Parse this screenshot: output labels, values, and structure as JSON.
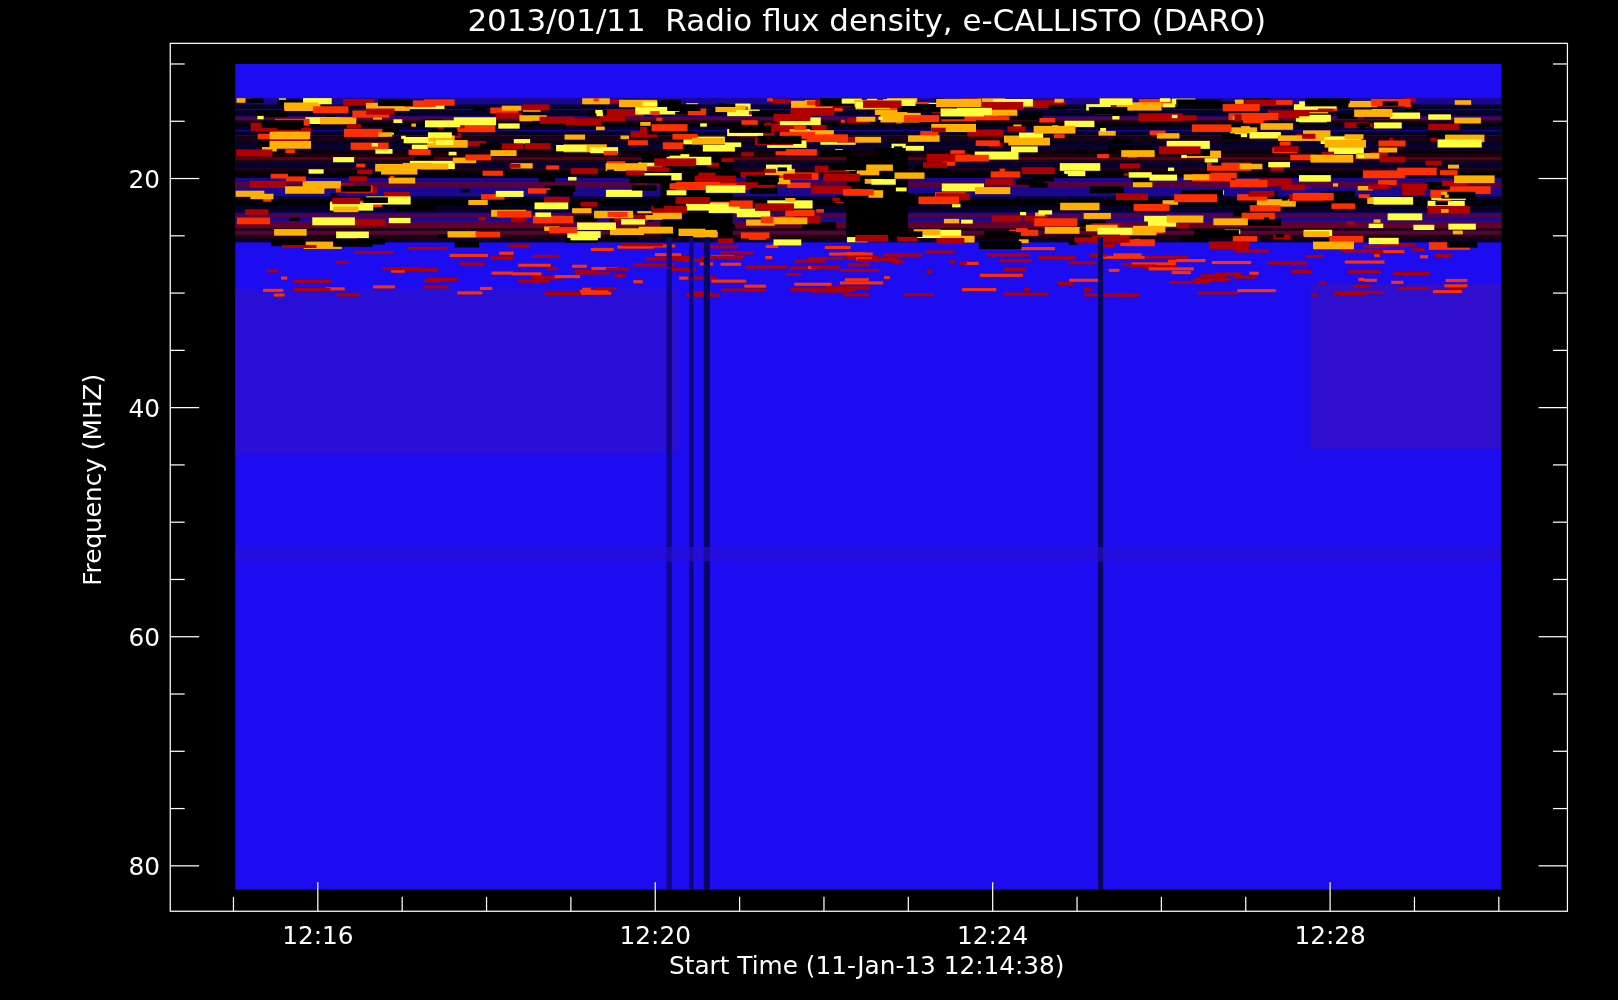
{
  "title": "2013/01/11  Radio flux density, e-CALLISTO (DARO)",
  "x_axis": {
    "label": "Start Time (11-Jan-13 12:14:38)",
    "tick_labels": [
      "12:16",
      "12:20",
      "12:24",
      "12:28"
    ]
  },
  "y_axis": {
    "label": "Frequency (MHZ)",
    "tick_labels": [
      "20",
      "40",
      "60",
      "80"
    ]
  }
}
